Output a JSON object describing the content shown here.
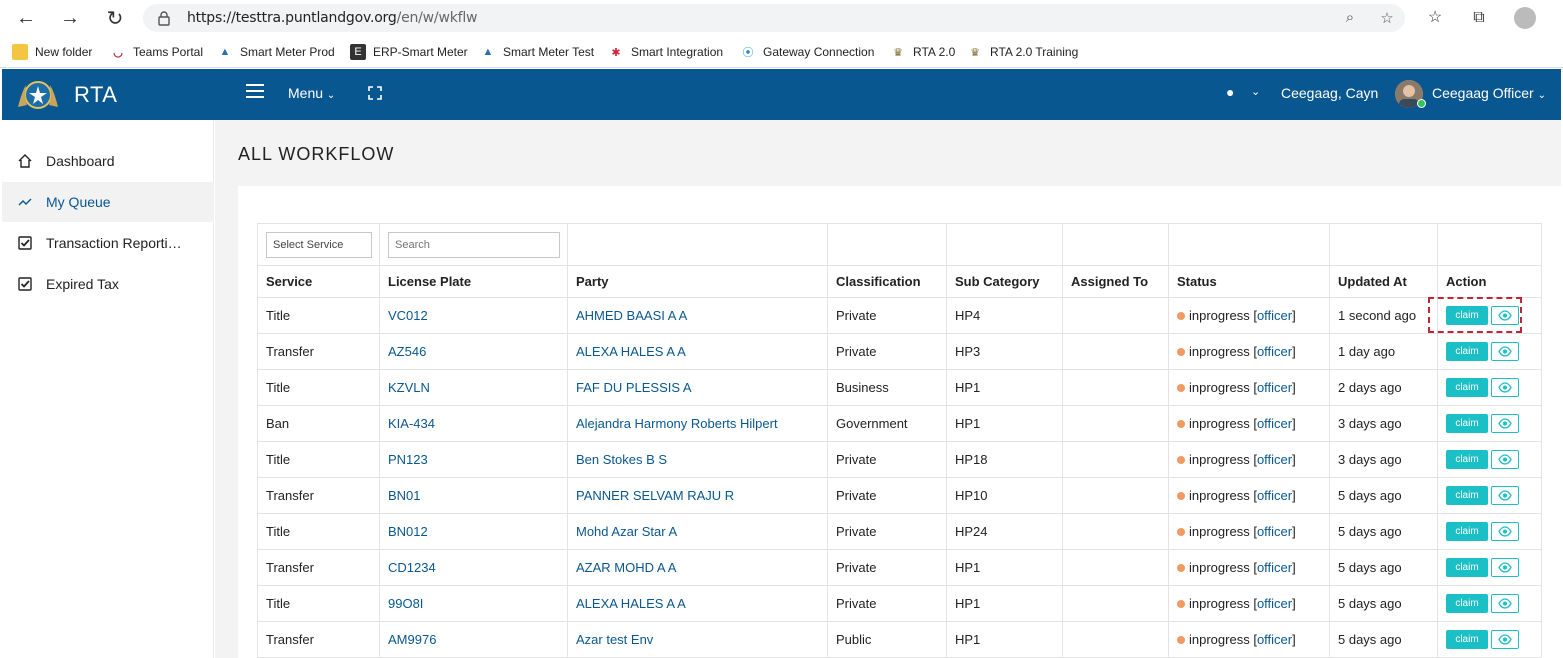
{
  "browser": {
    "url_host": "https://testtra.puntlandgov.org",
    "url_path": "/en/w/wkflw"
  },
  "bookmarks": [
    {
      "label": "New folder",
      "icon": "folder-icon"
    },
    {
      "label": "Teams Portal",
      "icon": "teams-portal-icon"
    },
    {
      "label": "Smart Meter Prod",
      "icon": "drop-icon"
    },
    {
      "label": "ERP-Smart Meter",
      "icon": "erp-icon"
    },
    {
      "label": "Smart Meter Test",
      "icon": "drop-icon"
    },
    {
      "label": "Smart Integration",
      "icon": "integration-icon"
    },
    {
      "label": "Gateway Connection",
      "icon": "gateway-icon"
    },
    {
      "label": "RTA 2.0",
      "icon": "emblem-icon"
    },
    {
      "label": "RTA 2.0 Training",
      "icon": "emblem-icon"
    }
  ],
  "header": {
    "brand": "RTA",
    "menu_label": "Menu",
    "user_name": "Ceegaag, Cayn",
    "role": "Ceegaag Officer"
  },
  "sidebar": {
    "items": [
      {
        "label": "Dashboard",
        "icon": "home-icon"
      },
      {
        "label": "My Queue",
        "icon": "trend-icon"
      },
      {
        "label": "Transaction Reporting",
        "icon": "check-square-icon"
      },
      {
        "label": "Expired Tax",
        "icon": "check-square-icon"
      }
    ]
  },
  "page": {
    "title": "ALL WORKFLOW"
  },
  "filters": {
    "service_placeholder": "Select Service",
    "search_placeholder": "Search"
  },
  "table": {
    "columns": [
      "Service",
      "License Plate",
      "Party",
      "Classification",
      "Sub Category",
      "Assigned To",
      "Status",
      "Updated At",
      "Action"
    ],
    "claim_label": "claim",
    "rows": [
      {
        "service": "Title",
        "plate": "VC012",
        "party": "AHMED BAASI A A",
        "classification": "Private",
        "sub": "HP4",
        "assigned": "",
        "status": "inprogress",
        "role": "officer",
        "updated": "1 second ago"
      },
      {
        "service": "Transfer",
        "plate": "AZ546",
        "party": "ALEXA HALES A A",
        "classification": "Private",
        "sub": "HP3",
        "assigned": "",
        "status": "inprogress",
        "role": "officer",
        "updated": "1 day ago"
      },
      {
        "service": "Title",
        "plate": "KZVLN",
        "party": "FAF DU PLESSIS A",
        "classification": "Business",
        "sub": "HP1",
        "assigned": "",
        "status": "inprogress",
        "role": "officer",
        "updated": "2 days ago"
      },
      {
        "service": "Ban",
        "plate": "KIA-434",
        "party": "Alejandra Harmony Roberts Hilpert",
        "classification": "Government",
        "sub": "HP1",
        "assigned": "",
        "status": "inprogress",
        "role": "officer",
        "updated": "3 days ago"
      },
      {
        "service": "Title",
        "plate": "PN123",
        "party": "Ben Stokes B S",
        "classification": "Private",
        "sub": "HP18",
        "assigned": "",
        "status": "inprogress",
        "role": "officer",
        "updated": "3 days ago"
      },
      {
        "service": "Transfer",
        "plate": "BN01",
        "party": "PANNER SELVAM RAJU R",
        "classification": "Private",
        "sub": "HP10",
        "assigned": "",
        "status": "inprogress",
        "role": "officer",
        "updated": "5 days ago"
      },
      {
        "service": "Title",
        "plate": "BN012",
        "party": "Mohd Azar Star A",
        "classification": "Private",
        "sub": "HP24",
        "assigned": "",
        "status": "inprogress",
        "role": "officer",
        "updated": "5 days ago"
      },
      {
        "service": "Transfer",
        "plate": "CD1234",
        "party": "AZAR MOHD A A",
        "classification": "Private",
        "sub": "HP1",
        "assigned": "",
        "status": "inprogress",
        "role": "officer",
        "updated": "5 days ago"
      },
      {
        "service": "Title",
        "plate": "99O8I",
        "party": "ALEXA HALES A A",
        "classification": "Private",
        "sub": "HP1",
        "assigned": "",
        "status": "inprogress",
        "role": "officer",
        "updated": "5 days ago"
      },
      {
        "service": "Transfer",
        "plate": "AM9976",
        "party": "Azar test Env",
        "classification": "Public",
        "sub": "HP1",
        "assigned": "",
        "status": "inprogress",
        "role": "officer",
        "updated": "5 days ago"
      }
    ]
  },
  "colors": {
    "header_bg": "#095791",
    "link": "#095791",
    "claim_button": "#1ac0c6",
    "status_dot": "#f29a62",
    "highlight": "#c0263a"
  }
}
